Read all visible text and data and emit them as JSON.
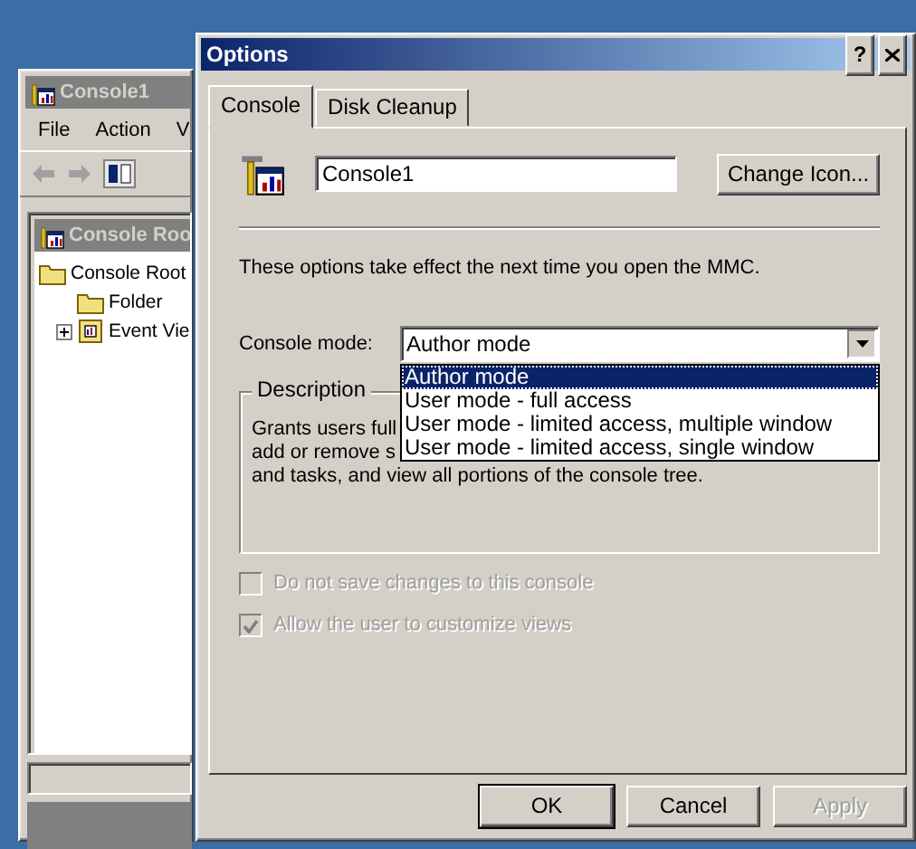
{
  "background_window": {
    "title": "Console1",
    "menu": [
      {
        "label": "File"
      },
      {
        "label": "Action"
      },
      {
        "label": "V"
      }
    ],
    "child_window": {
      "title": "Console Roo",
      "tree": [
        {
          "label": "Console Root",
          "kind": "folder",
          "expanded": true,
          "children": [
            {
              "label": "Folder",
              "kind": "folder"
            },
            {
              "label": "Event Vie",
              "kind": "snapin",
              "expanded": false
            }
          ]
        }
      ]
    }
  },
  "dialog": {
    "title": "Options",
    "help_button": "?",
    "tabs": [
      {
        "label": "Console",
        "selected": true
      },
      {
        "label": "Disk Cleanup",
        "selected": false
      }
    ],
    "console_name": {
      "value": "Console1"
    },
    "change_icon_button": "Change Icon...",
    "note": "These options take effect the next time you open the MMC.",
    "console_mode": {
      "label": "Console mode:",
      "value": "Author mode",
      "expanded": true,
      "options": [
        {
          "label": "Author mode",
          "selected": true
        },
        {
          "label": "User mode - full access",
          "selected": false
        },
        {
          "label": "User mode - limited access, multiple window",
          "selected": false
        },
        {
          "label": "User mode - limited access, single window",
          "selected": false
        }
      ]
    },
    "description": {
      "title": "Description",
      "lines": [
        "Grants users full",
        "add or remove s",
        "and tasks, and view all portions of the console tree."
      ]
    },
    "checkboxes": [
      {
        "label": "Do not save changes to this console",
        "checked": false,
        "disabled": true
      },
      {
        "label": "Allow the user to customize views",
        "checked": true,
        "disabled": true
      }
    ],
    "buttons": [
      {
        "label": "OK",
        "default": true,
        "disabled": false
      },
      {
        "label": "Cancel",
        "default": false,
        "disabled": false
      },
      {
        "label": "Apply",
        "default": false,
        "disabled": true
      }
    ]
  }
}
